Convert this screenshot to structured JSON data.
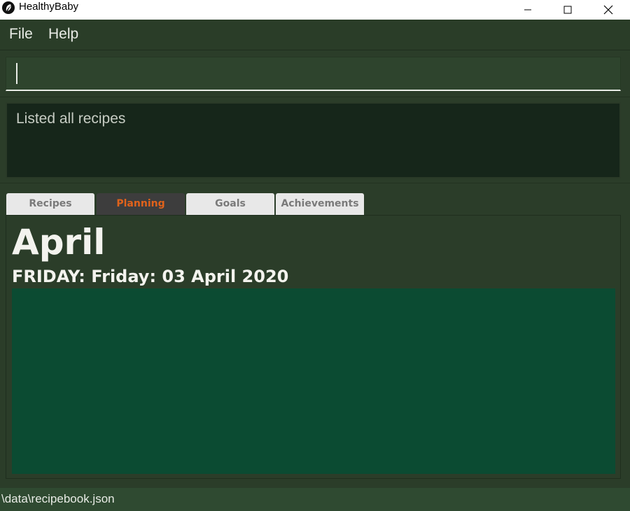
{
  "window": {
    "title": "HealthyBaby",
    "app_icon": "leaf-icon",
    "controls": [
      "minimize-icon",
      "maximize-icon",
      "close-icon"
    ]
  },
  "menu": {
    "file": "File",
    "help": "Help"
  },
  "command": {
    "value": ""
  },
  "result": {
    "message": "Listed all recipes"
  },
  "tabs": [
    {
      "label": "Recipes",
      "selected": false
    },
    {
      "label": "Planning",
      "selected": true
    },
    {
      "label": "Goals",
      "selected": false
    },
    {
      "label": "Achievements",
      "selected": false
    }
  ],
  "planning": {
    "month": "April",
    "day_header": "FRIDAY: Friday: 03 April 2020"
  },
  "status": {
    "path": "\\data\\recipebook.json"
  },
  "colors": {
    "background": "#2b3d29",
    "selected_tab_text": "#e0621b",
    "list_area": "#0b4b32"
  }
}
